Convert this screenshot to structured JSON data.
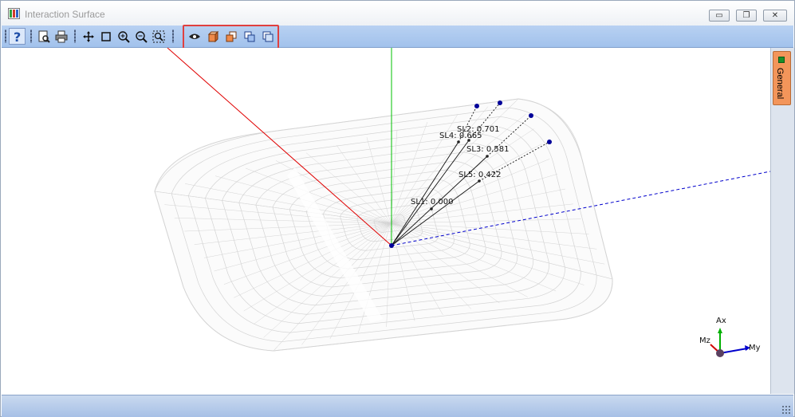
{
  "window": {
    "title": "Interaction Surface"
  },
  "titlebar": {
    "minimize_glyph": "▭",
    "restore_glyph": "❐",
    "close_glyph": "✕"
  },
  "toolbar": {
    "items": [
      {
        "name": "help-icon",
        "group": "help"
      },
      {
        "name": "print-preview-icon",
        "group": "print"
      },
      {
        "name": "print-icon",
        "group": "print"
      },
      {
        "name": "pan-icon",
        "group": "view"
      },
      {
        "name": "select-box-icon",
        "group": "view"
      },
      {
        "name": "zoom-in-icon",
        "group": "view"
      },
      {
        "name": "zoom-out-icon",
        "group": "view"
      },
      {
        "name": "zoom-extents-icon",
        "group": "view"
      },
      {
        "name": "eye-view-icon",
        "group": "render"
      },
      {
        "name": "solid-view-icon",
        "group": "render"
      },
      {
        "name": "front-view-icon",
        "group": "render"
      },
      {
        "name": "side-view-icon",
        "group": "render"
      },
      {
        "name": "top-view-icon",
        "group": "render"
      }
    ]
  },
  "side_panel": {
    "tab_label": "General"
  },
  "plot": {
    "load_labels": [
      {
        "id": "SL1",
        "text": "SL1: 0.000"
      },
      {
        "id": "SL2",
        "text": "SL2: 0.701"
      },
      {
        "id": "SL3",
        "text": "SL3: 0.581"
      },
      {
        "id": "SL4",
        "text": "SL4: 0.665"
      },
      {
        "id": "SL5",
        "text": "SL5: 0.422"
      }
    ],
    "axes": {
      "axial": "Ax",
      "moment_z": "Mz",
      "moment_y": "My"
    },
    "colors": {
      "surface": "#d4d4d4",
      "x_axis": "#e00000",
      "y_axis": "#00c000",
      "z_axis": "#0000cc",
      "load_point": "#000099"
    }
  }
}
